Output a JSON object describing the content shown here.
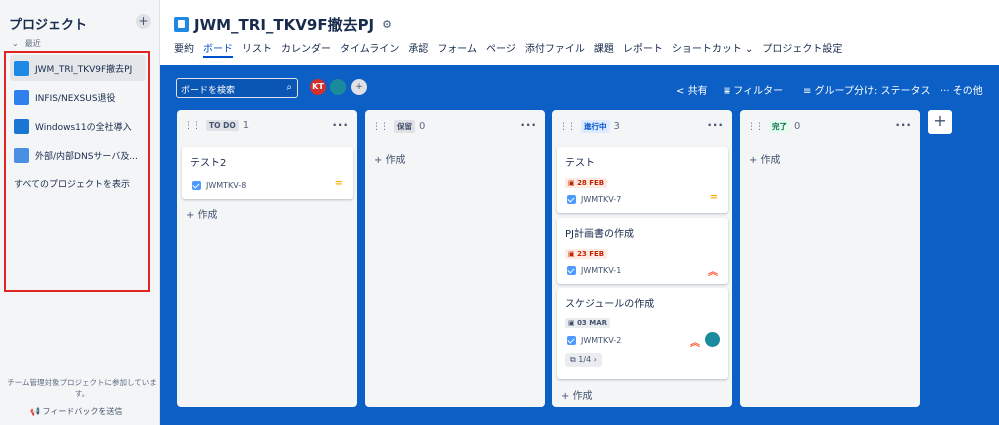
{
  "sidebar": {
    "header": "プロジェクト",
    "add_label": "+",
    "recent_label": "最近",
    "projects": [
      {
        "name": "JWM_TRI_TKV9F撤去PJ",
        "icon": "notepad-icon"
      },
      {
        "name": "INFIS/NEXSUS退役",
        "icon": "tools-icon"
      },
      {
        "name": "Windows11の全社導入",
        "icon": "browser-icon"
      },
      {
        "name": "外部/内部DNSサーバ及...",
        "icon": "lifebuoy-icon"
      }
    ],
    "show_all": "すべてのプロジェクトを表示",
    "footer_text": "チーム管理対象プロジェクトに参加しています。",
    "feedback": "フィードバックを送信"
  },
  "header": {
    "project_name": "JWM_TRI_TKV9F撤去PJ",
    "tabs": [
      "要約",
      "ボード",
      "リスト",
      "カレンダー",
      "タイムライン",
      "承認",
      "フォーム",
      "ページ",
      "添付ファイル",
      "課題",
      "レポート",
      "ショートカット",
      "プロジェクト設定"
    ],
    "active_tab": "ボード",
    "shortcut_chevron": "⌄"
  },
  "toolbar": {
    "search_placeholder": "ボードを検索",
    "avatar_initials": "KT",
    "avatar_sub": "K",
    "share": "共有",
    "filter": "フィルター",
    "group_by": "グループ分け: ステータス",
    "more": "その他"
  },
  "columns": [
    {
      "label": "TO DO",
      "count": "1",
      "create": "作成"
    },
    {
      "label": "保留",
      "count": "0",
      "create": "作成"
    },
    {
      "label": "進行中",
      "count": "3",
      "create": "作成"
    },
    {
      "label": "完了",
      "count": "0",
      "create": "作成"
    }
  ],
  "cards": {
    "todo": [
      {
        "title": "テスト2",
        "key": "JWMTKV-8",
        "priority": "medium"
      }
    ],
    "in_progress": [
      {
        "title": "テスト",
        "due": "28 FEB",
        "key": "JWMTKV-7",
        "priority": "medium"
      },
      {
        "title": "PJ計画書の作成",
        "due": "23 FEB",
        "key": "JWMTKV-1",
        "priority": "high"
      },
      {
        "title": "スケジュールの作成",
        "due": "03 MAR",
        "key": "JWMTKV-2",
        "priority": "high",
        "subtasks": "1/4"
      }
    ]
  },
  "colors": {
    "board_bg": "#0c5fc4",
    "active_tab": "#0052cc",
    "highlight_box": "#e02424",
    "todo_label": "#dfe1e6",
    "in_progress_label": "#deebff",
    "done_label": "#e3fcef",
    "priority_medium": "#ffab00",
    "priority_high": "#ff5630"
  }
}
